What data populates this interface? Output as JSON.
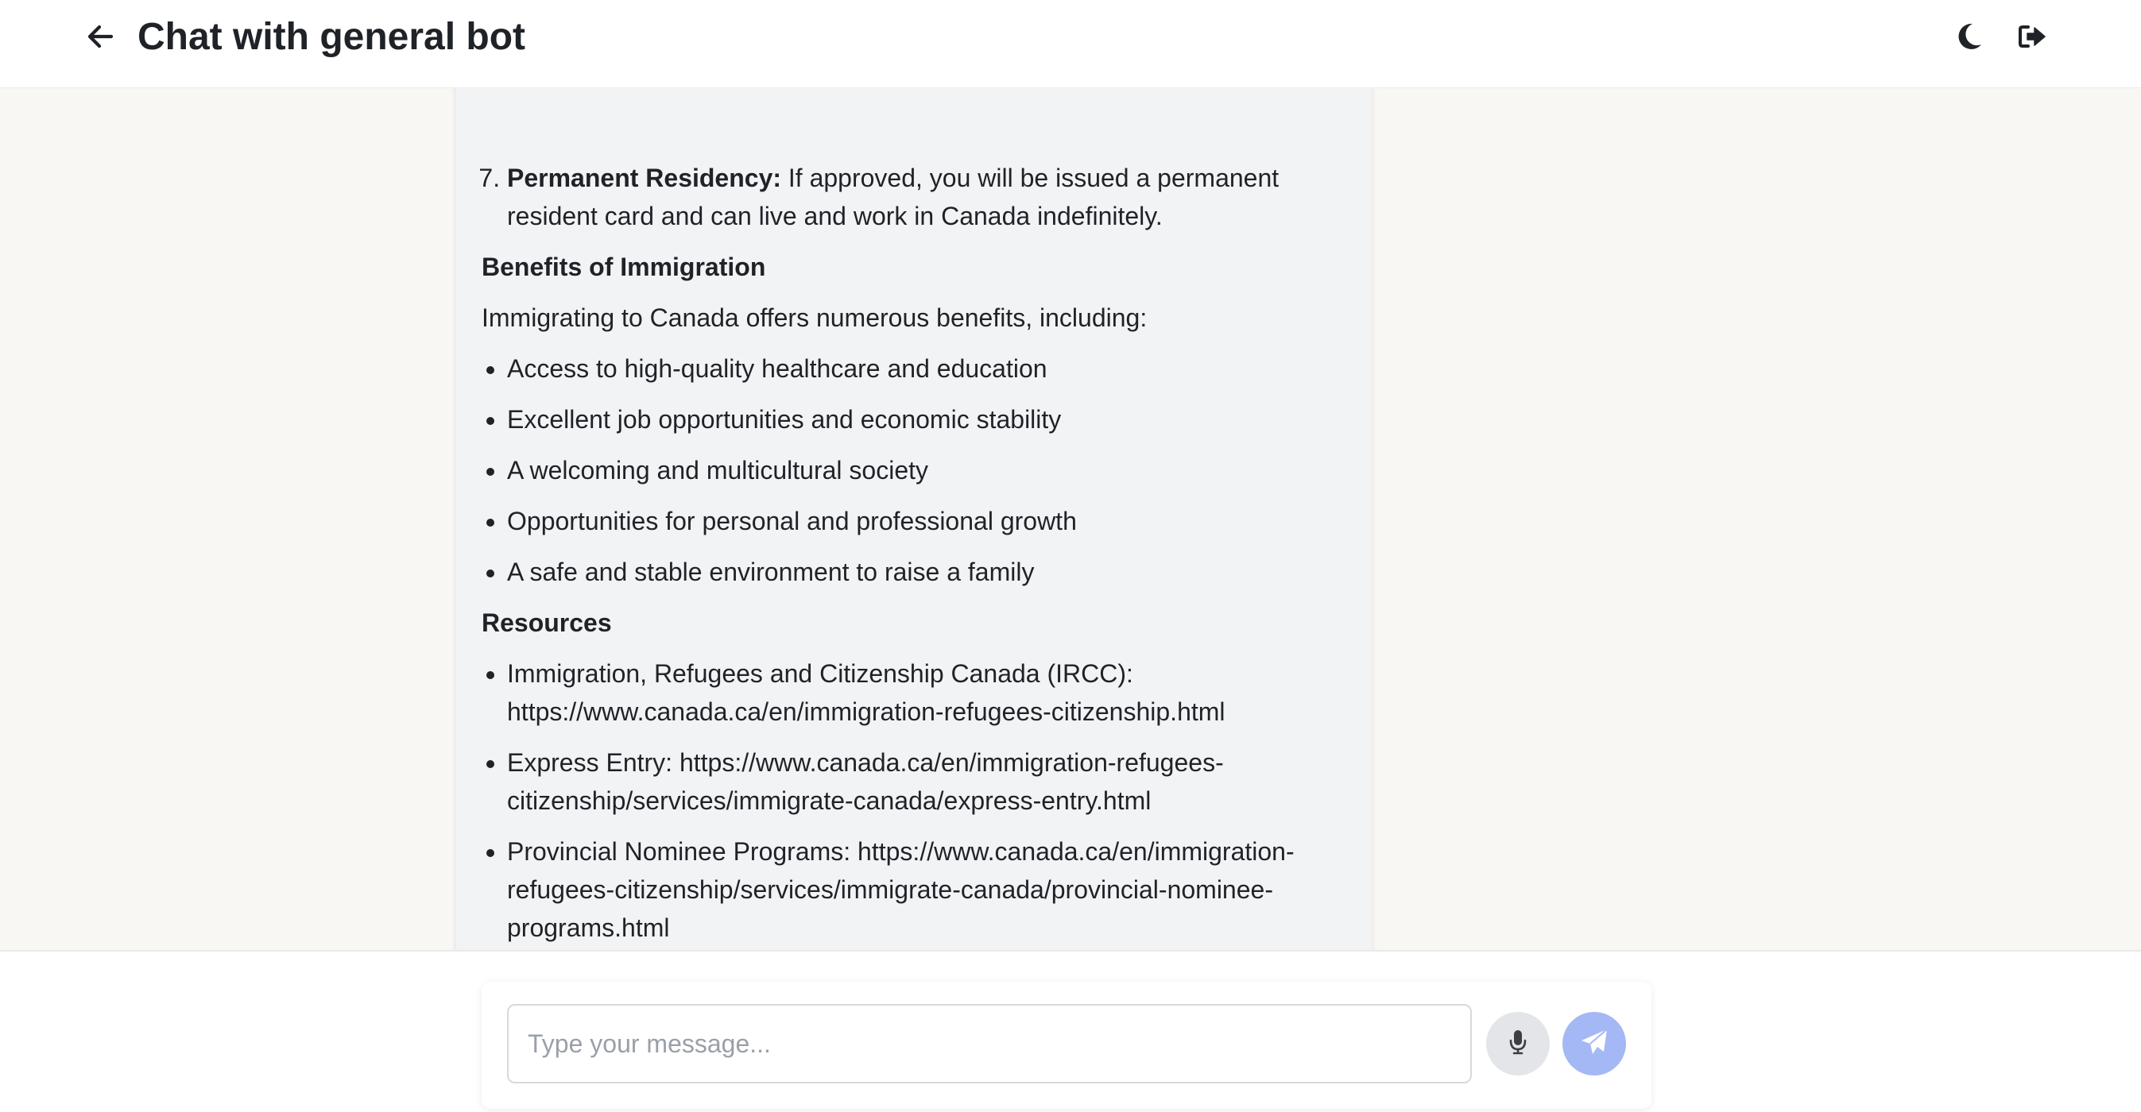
{
  "header": {
    "title": "Chat with general bot",
    "back_icon": "arrow-left-icon",
    "theme_icon": "moon-icon",
    "logout_icon": "sign-out-icon"
  },
  "message": {
    "steps": [
      {
        "number": "7.",
        "bold": "Permanent Residency:",
        "text": " If approved, you will be issued a permanent resident card and can live and work in Canada indefinitely."
      }
    ],
    "benefits_heading": "Benefits of Immigration",
    "benefits_intro": "Immigrating to Canada offers numerous benefits, including:",
    "benefits": [
      "Access to high-quality healthcare and education",
      "Excellent job opportunities and economic stability",
      "A welcoming and multicultural society",
      "Opportunities for personal and professional growth",
      "A safe and stable environment to raise a family"
    ],
    "resources_heading": "Resources",
    "resources": [
      "Immigration, Refugees and Citizenship Canada (IRCC): https://www.canada.ca/en/immigration-refugees-citizenship.html",
      "Express Entry: https://www.canada.ca/en/immigration-refugees-citizenship/services/immigrate-canada/express-entry.html",
      "Provincial Nominee Programs: https://www.canada.ca/en/immigration-refugees-citizenship/services/immigrate-canada/provincial-nominee-programs.html"
    ]
  },
  "composer": {
    "placeholder": "Type your message...",
    "value": "",
    "mic_icon": "microphone-icon",
    "send_icon": "paper-plane-icon"
  },
  "colors": {
    "send_button": "#a3b8f5",
    "mic_button": "#e4e5e8",
    "bubble": "#f2f3f5",
    "page_background": "#f8f7f4"
  }
}
